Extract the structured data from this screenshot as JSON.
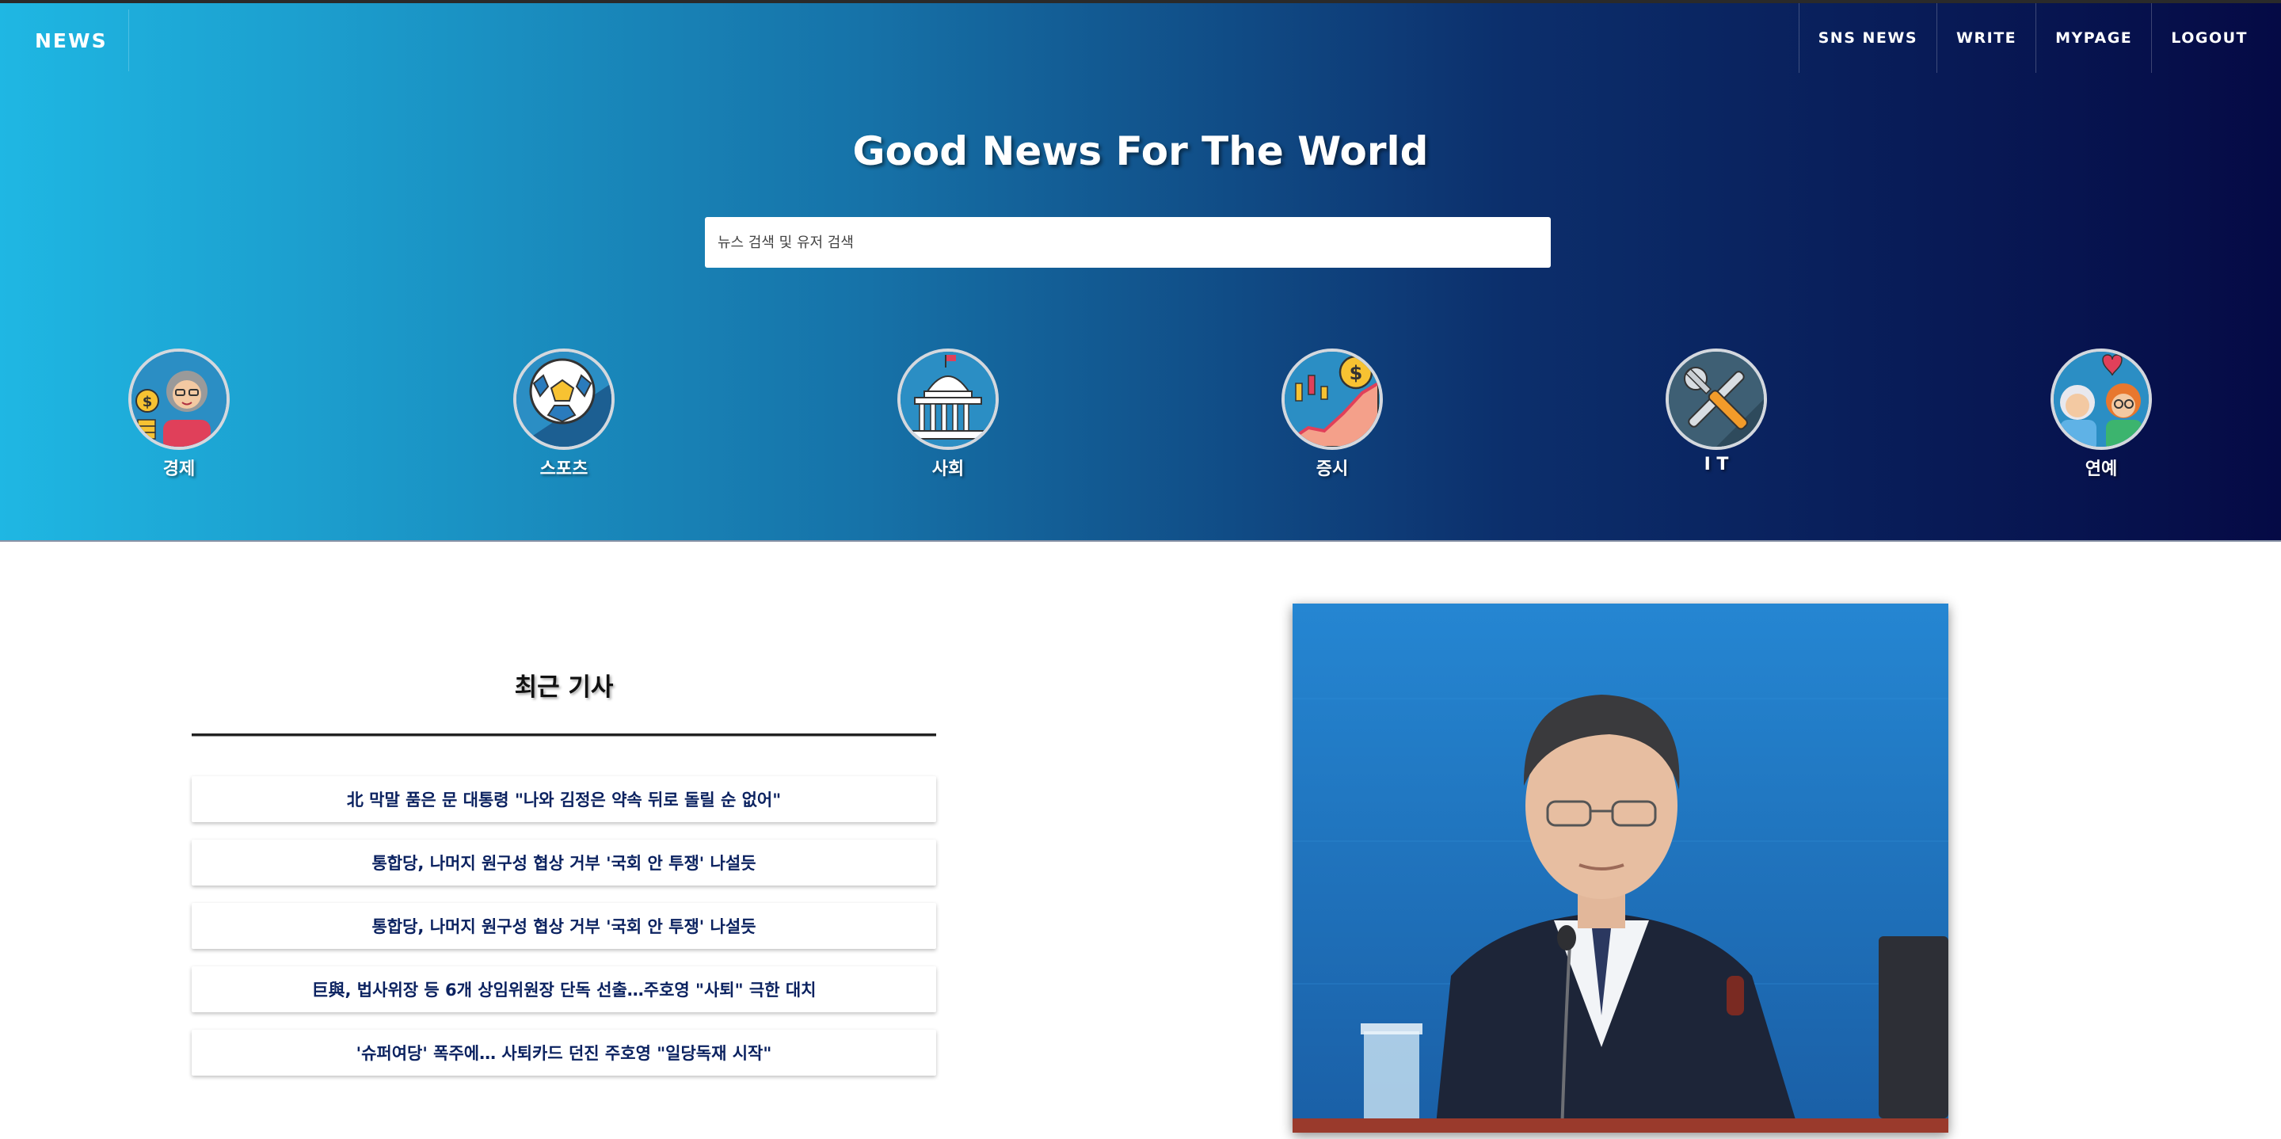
{
  "header": {
    "brand": "NEWS",
    "nav": [
      {
        "label": "SNS NEWS"
      },
      {
        "label": "WRITE"
      },
      {
        "label": "MYPAGE"
      },
      {
        "label": "LOGOUT"
      }
    ]
  },
  "hero": {
    "title": "Good News For The World",
    "search_placeholder": "뉴스 검색 및 유저 검색",
    "categories": [
      {
        "label": "경제",
        "icon": "economy-woman-coin-icon"
      },
      {
        "label": "스포츠",
        "icon": "soccer-ball-icon"
      },
      {
        "label": "사회",
        "icon": "capitol-building-icon"
      },
      {
        "label": "증시",
        "icon": "stock-chart-coin-icon"
      },
      {
        "label": "I T",
        "icon": "wrench-screwdriver-icon"
      },
      {
        "label": "연예",
        "icon": "celebrity-couple-heart-icon"
      }
    ]
  },
  "recent": {
    "heading": "최근 기사",
    "articles": [
      {
        "title": "北 막말 품은 문 대통령 \"나와 김정은 약속 뒤로 돌릴 순 없어\""
      },
      {
        "title": "통합당, 나머지 원구성 협상 거부 '국회 안 투쟁' 나설듯"
      },
      {
        "title": "통합당, 나머지 원구성 협상 거부 '국회 안 투쟁' 나설듯"
      },
      {
        "title": "巨與, 법사위장 등 6개 상임위원장 단독 선출…주호영 \"사퇴\" 극한 대치"
      },
      {
        "title": "'슈퍼여당' 폭주에… 사퇴카드 던진 주호영 \"일당독재 시작\""
      }
    ]
  },
  "featured_photo": {
    "icon": "president-speaking-photo"
  },
  "colors": {
    "gradient_start": "#1fb7e3",
    "gradient_end": "#050a45",
    "article_text": "#0b2260"
  }
}
